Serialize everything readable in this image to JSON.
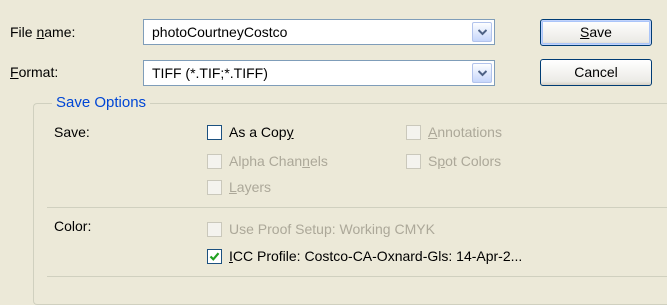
{
  "file_name": {
    "label_pre": "File ",
    "label_mnemonic": "n",
    "label_post": "ame:",
    "value": "photoCourtneyCostco"
  },
  "format": {
    "label_mnemonic": "F",
    "label_post": "ormat:",
    "value": "TIFF (*.TIF;*.TIFF)"
  },
  "buttons": {
    "save_mnemonic": "S",
    "save_rest": "ave",
    "cancel": "Cancel"
  },
  "save_options": {
    "legend": "Save Options",
    "save_label": "Save:",
    "as_a_copy": {
      "pre": "As a Cop",
      "mn": "y",
      "post": "",
      "checked": false,
      "enabled": true
    },
    "annotations": {
      "pre": "",
      "mn": "A",
      "post": "nnotations",
      "checked": false,
      "enabled": false
    },
    "alpha_channels": {
      "pre": "Alpha Chan",
      "mn": "n",
      "post": "els",
      "checked": false,
      "enabled": false
    },
    "spot_colors": {
      "pre": "S",
      "mn": "p",
      "post": "ot Colors",
      "checked": false,
      "enabled": false
    },
    "layers": {
      "pre": "",
      "mn": "L",
      "post": "ayers",
      "checked": false,
      "enabled": false
    },
    "color_label": "Color:",
    "use_proof_setup": {
      "text": "Use Proof Setup:  Working CMYK",
      "checked": false,
      "enabled": false
    },
    "icc_profile": {
      "mn": "I",
      "post": "CC Profile:  Costco-CA-Oxnard-Gls: 14-Apr-2...",
      "checked": true,
      "enabled": true
    }
  },
  "icons": {
    "dropdown": "chevron-down-icon",
    "check": "checkmark-icon"
  }
}
